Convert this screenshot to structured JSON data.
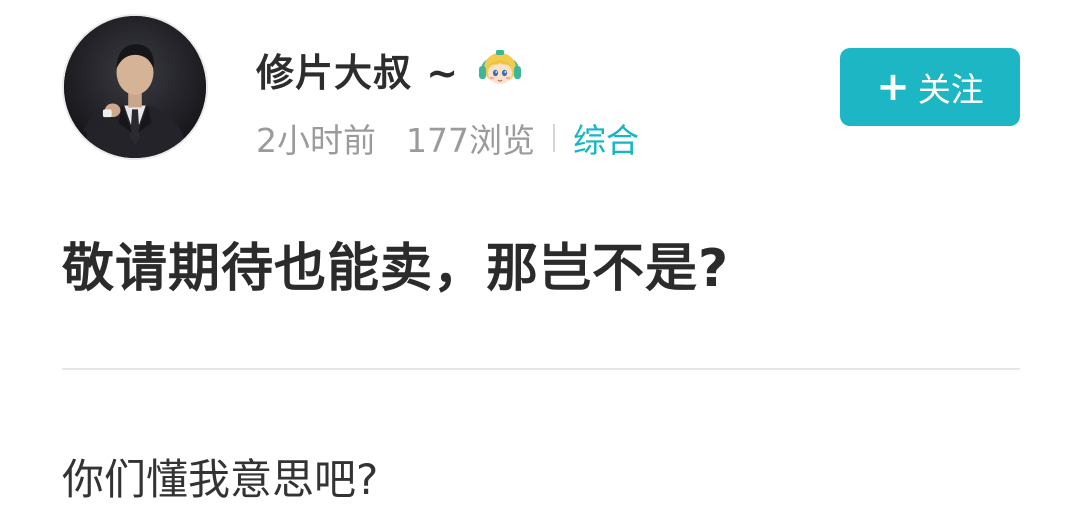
{
  "author": {
    "name": "修片大叔 ~",
    "avatar_icon": "person-portrait-avatar",
    "level_badge_icon": "cartoon-girl-level-badge"
  },
  "meta": {
    "time": "2小时前",
    "views": "177浏览",
    "category": "综合"
  },
  "follow_button": {
    "plus_icon": "+",
    "label": "关注"
  },
  "post": {
    "title": "敬请期待也能卖，那岂不是?",
    "body": "你们懂我意思吧?"
  },
  "colors": {
    "accent": "#1cb6c4",
    "category": "#16b6c2",
    "meta_text": "#9b9b9b",
    "title_text": "#2b2b2b"
  }
}
